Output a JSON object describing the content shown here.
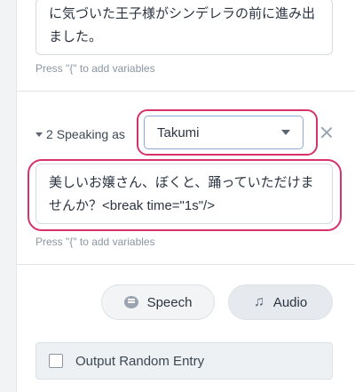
{
  "first_entry": {
    "text": "に気づいた王子様がシンデレラの前に進み出ました。",
    "hint": "Press \"{\" to add variables"
  },
  "step": {
    "number": "2",
    "label": "Speaking as",
    "voice_selected": "Takumi",
    "text": "美しいお嬢さん、ぼくと、踊っていただけませんか？<break time=\"1s\"/>",
    "hint": "Press \"{\" to add variables"
  },
  "buttons": {
    "speech": "Speech",
    "audio": "Audio"
  },
  "output_random": {
    "label": "Output Random Entry",
    "checked": false
  },
  "colors": {
    "highlight": "#d6336c",
    "select_border": "#8fa9d6"
  }
}
